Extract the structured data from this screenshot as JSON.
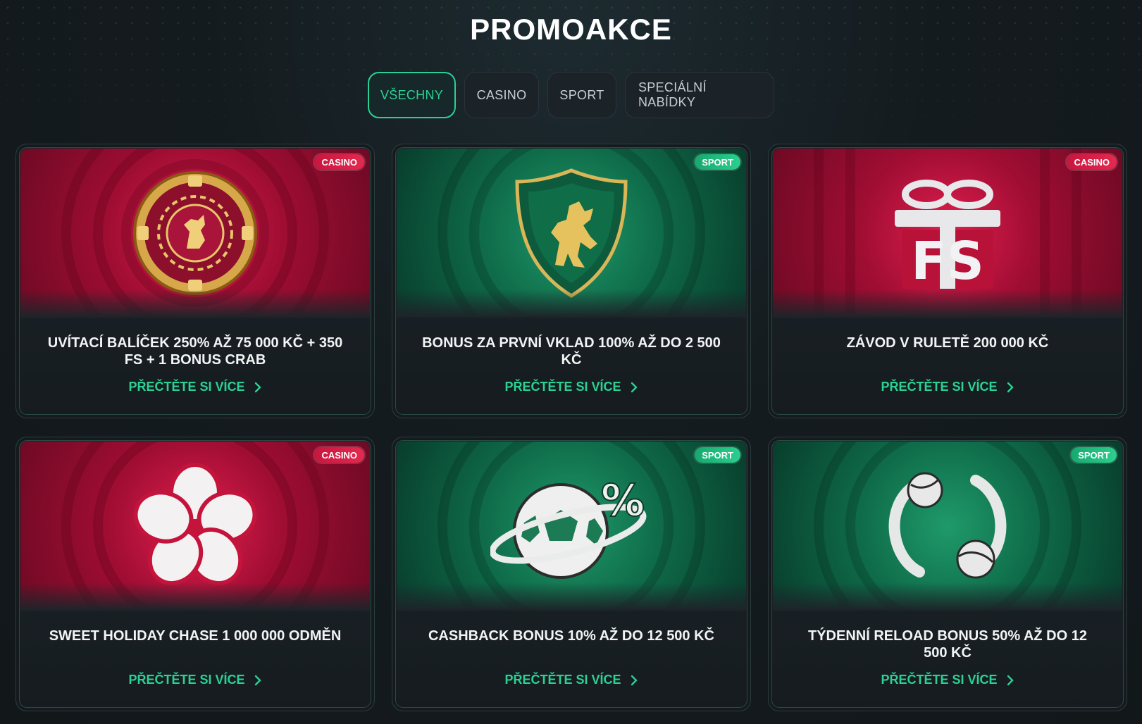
{
  "page": {
    "title": "PROMOAKCE"
  },
  "tabs": [
    {
      "label": "VŠECHNY",
      "active": true
    },
    {
      "label": "CASINO",
      "active": false
    },
    {
      "label": "SPORT",
      "active": false
    },
    {
      "label": "SPECIÁLNÍ NABÍDKY",
      "active": false
    }
  ],
  "colors": {
    "accent": "#2bd193",
    "casino_badge": "#e5294f",
    "sport_badge": "#2bcf8d",
    "background": "#141b1f"
  },
  "cards": [
    {
      "badge": "CASINO",
      "title": "UVÍTACÍ BALÍČEK 250% AŽ 75 000 KČ + 350 FS + 1 BONUS CRAB",
      "cta": "PŘEČTĚTE SI VÍCE",
      "icon": "poker-chip-lion-icon"
    },
    {
      "badge": "SPORT",
      "title": "BONUS ZA PRVNÍ VKLAD 100% AŽ DO 2 500 KČ",
      "cta": "PŘEČTĚTE SI VÍCE",
      "icon": "lion-shield-icon"
    },
    {
      "badge": "CASINO",
      "title": "ZÁVOD V RULETĚ 200 000 KČ",
      "cta": "PŘEČTĚTE SI VÍCE",
      "icon": "gift-fs-icon",
      "art_text": "FS"
    },
    {
      "badge": "CASINO",
      "title": "SWEET HOLIDAY CHASE 1 000 000 ODMĚN",
      "cta": "PŘEČTĚTE SI VÍCE",
      "icon": "flower-icon"
    },
    {
      "badge": "SPORT",
      "title": "CASHBACK BONUS 10% AŽ DO 12 500 KČ",
      "cta": "PŘEČTĚTE SI VÍCE",
      "icon": "football-percent-icon",
      "art_text": "%"
    },
    {
      "badge": "SPORT",
      "title": "TÝDENNÍ RELOAD BONUS 50% AŽ DO 12 500 KČ",
      "cta": "PŘEČTĚTE SI VÍCE",
      "icon": "tennis-balls-icon"
    }
  ]
}
